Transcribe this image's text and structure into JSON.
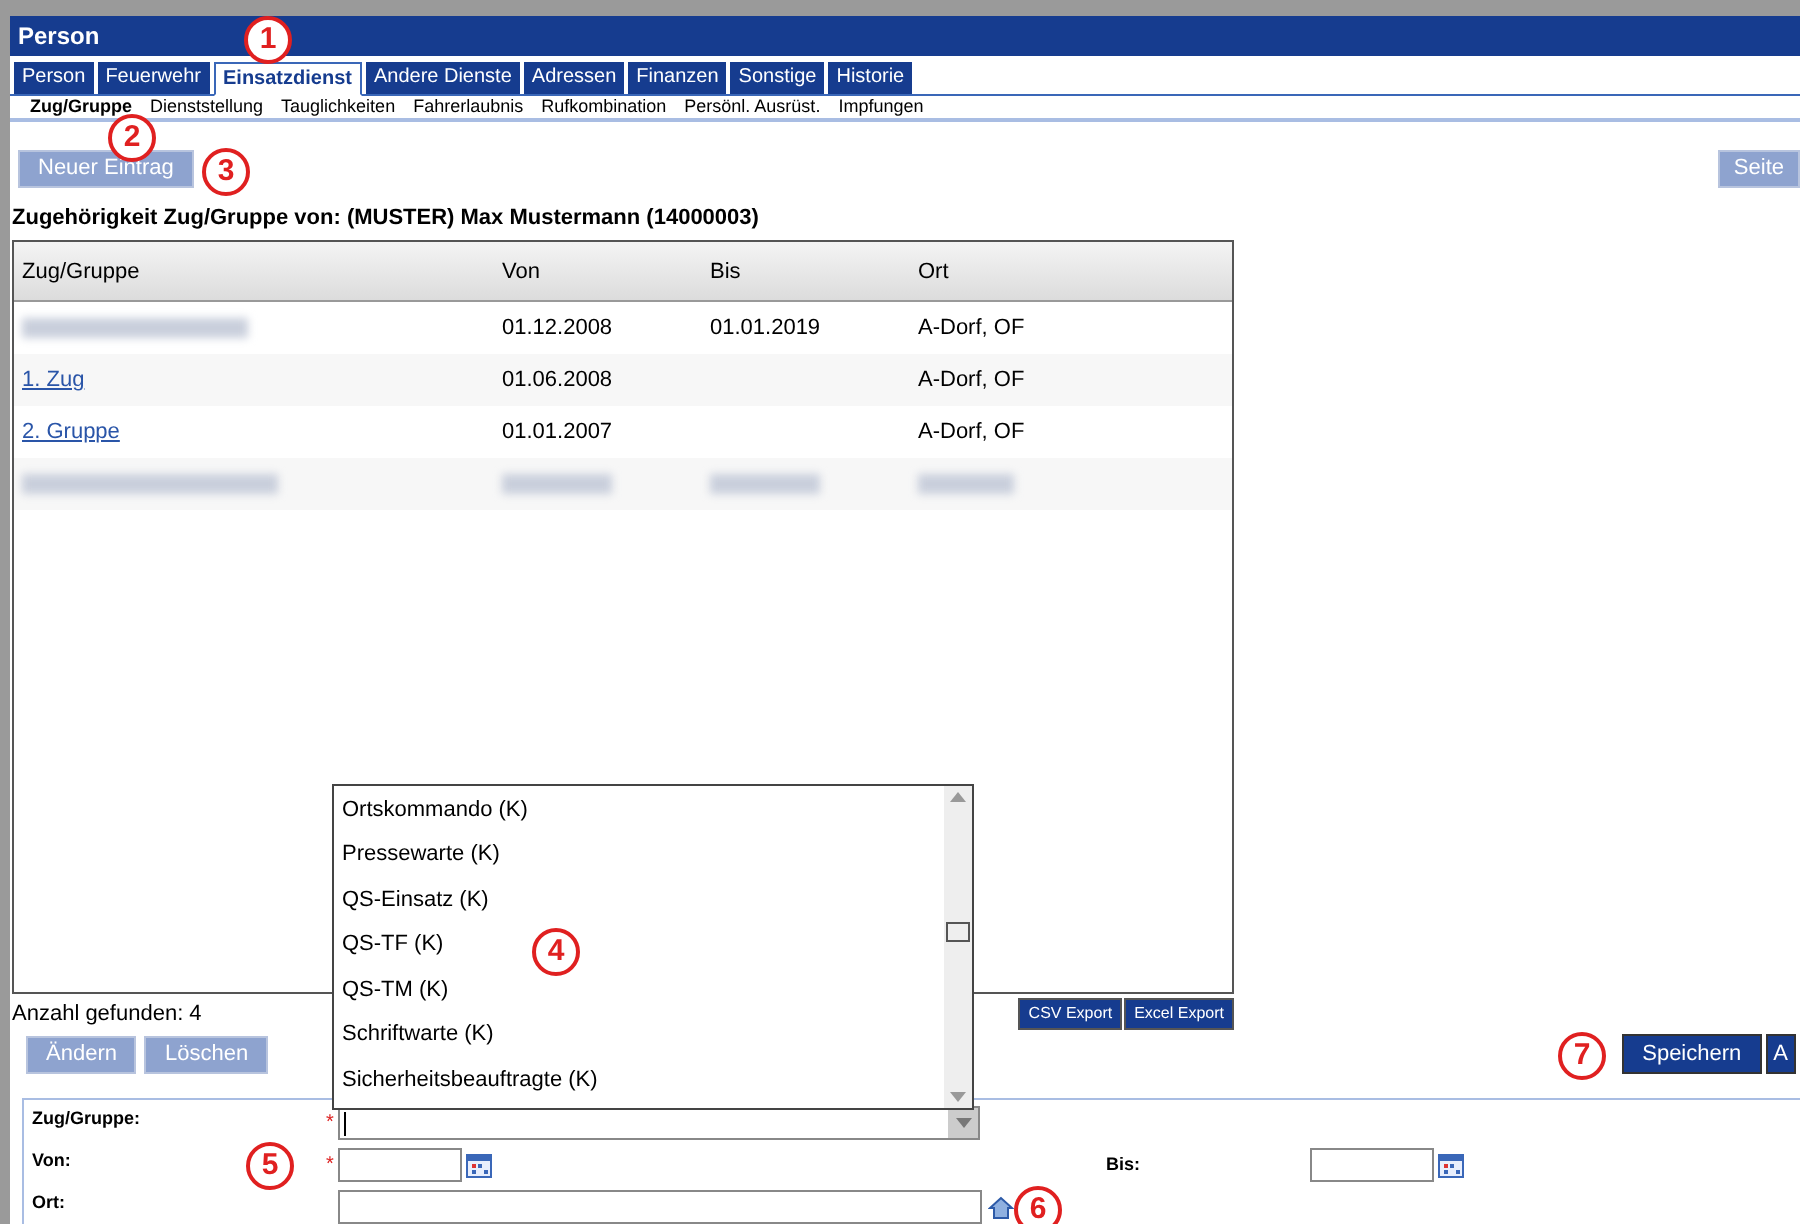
{
  "window": {
    "title": "Person"
  },
  "tabs": [
    {
      "label": "Person",
      "selected": false
    },
    {
      "label": "Feuerwehr",
      "selected": false
    },
    {
      "label": "Einsatzdienst",
      "selected": true
    },
    {
      "label": "Andere Dienste",
      "selected": false
    },
    {
      "label": "Adressen",
      "selected": false
    },
    {
      "label": "Finanzen",
      "selected": false
    },
    {
      "label": "Sonstige",
      "selected": false
    },
    {
      "label": "Historie",
      "selected": false
    }
  ],
  "subtabs": [
    {
      "label": "Zug/Gruppe",
      "selected": true
    },
    {
      "label": "Dienststellung",
      "selected": false
    },
    {
      "label": "Tauglichkeiten",
      "selected": false
    },
    {
      "label": "Fahrerlaubnis",
      "selected": false
    },
    {
      "label": "Rufkombination",
      "selected": false
    },
    {
      "label": "Persönl. Ausrüst.",
      "selected": false
    },
    {
      "label": "Impfungen",
      "selected": false
    }
  ],
  "toolbar": {
    "new_button": "Neuer Eintrag",
    "page_button": "Seite"
  },
  "heading": "Zugehörigkeit Zug/Gruppe von: (MUSTER) Max Mustermann (14000003)",
  "table": {
    "columns": [
      "Zug/Gruppe",
      "Von",
      "Bis",
      "Ort"
    ],
    "rows": [
      {
        "kind": "blurred"
      },
      {
        "kind": "plain",
        "group": "1. Zug",
        "from": "01.06.2008",
        "to": "",
        "place": "A-Dorf, OF"
      },
      {
        "kind": "plain",
        "group": "2. Gruppe",
        "from": "01.01.2007",
        "to": "",
        "place": "A-Dorf, OF"
      },
      {
        "kind": "blurred"
      }
    ],
    "first_row": {
      "from": "01.12.2008",
      "to": "01.01.2019",
      "place": "A-Dorf, OF"
    }
  },
  "count": "Anzahl gefunden: 4",
  "export_buttons": [
    "CSV Export",
    "Excel Export"
  ],
  "row_buttons": [
    "Ändern",
    "Löschen"
  ],
  "save_buttons": [
    "Speichern",
    "A"
  ],
  "form": {
    "fields": [
      {
        "label": "Zug/Gruppe:",
        "required": true,
        "kind": "combo"
      },
      {
        "label": "Von:",
        "required": true,
        "kind": "date"
      },
      {
        "label": "Ort:",
        "required": false,
        "kind": "place"
      }
    ],
    "to_label": "Bis:",
    "required_mark": "*"
  },
  "dropdown": {
    "options": [
      "Ortskommando (K)",
      "Pressewarte (K)",
      "QS-Einsatz (K)",
      "QS-TF (K)",
      "QS-TM (K)",
      "Schriftwarte (K)",
      "Sicherheitsbeauftragte (K)"
    ]
  },
  "annotations": [
    "1",
    "2",
    "3",
    "4",
    "5",
    "6",
    "7"
  ]
}
